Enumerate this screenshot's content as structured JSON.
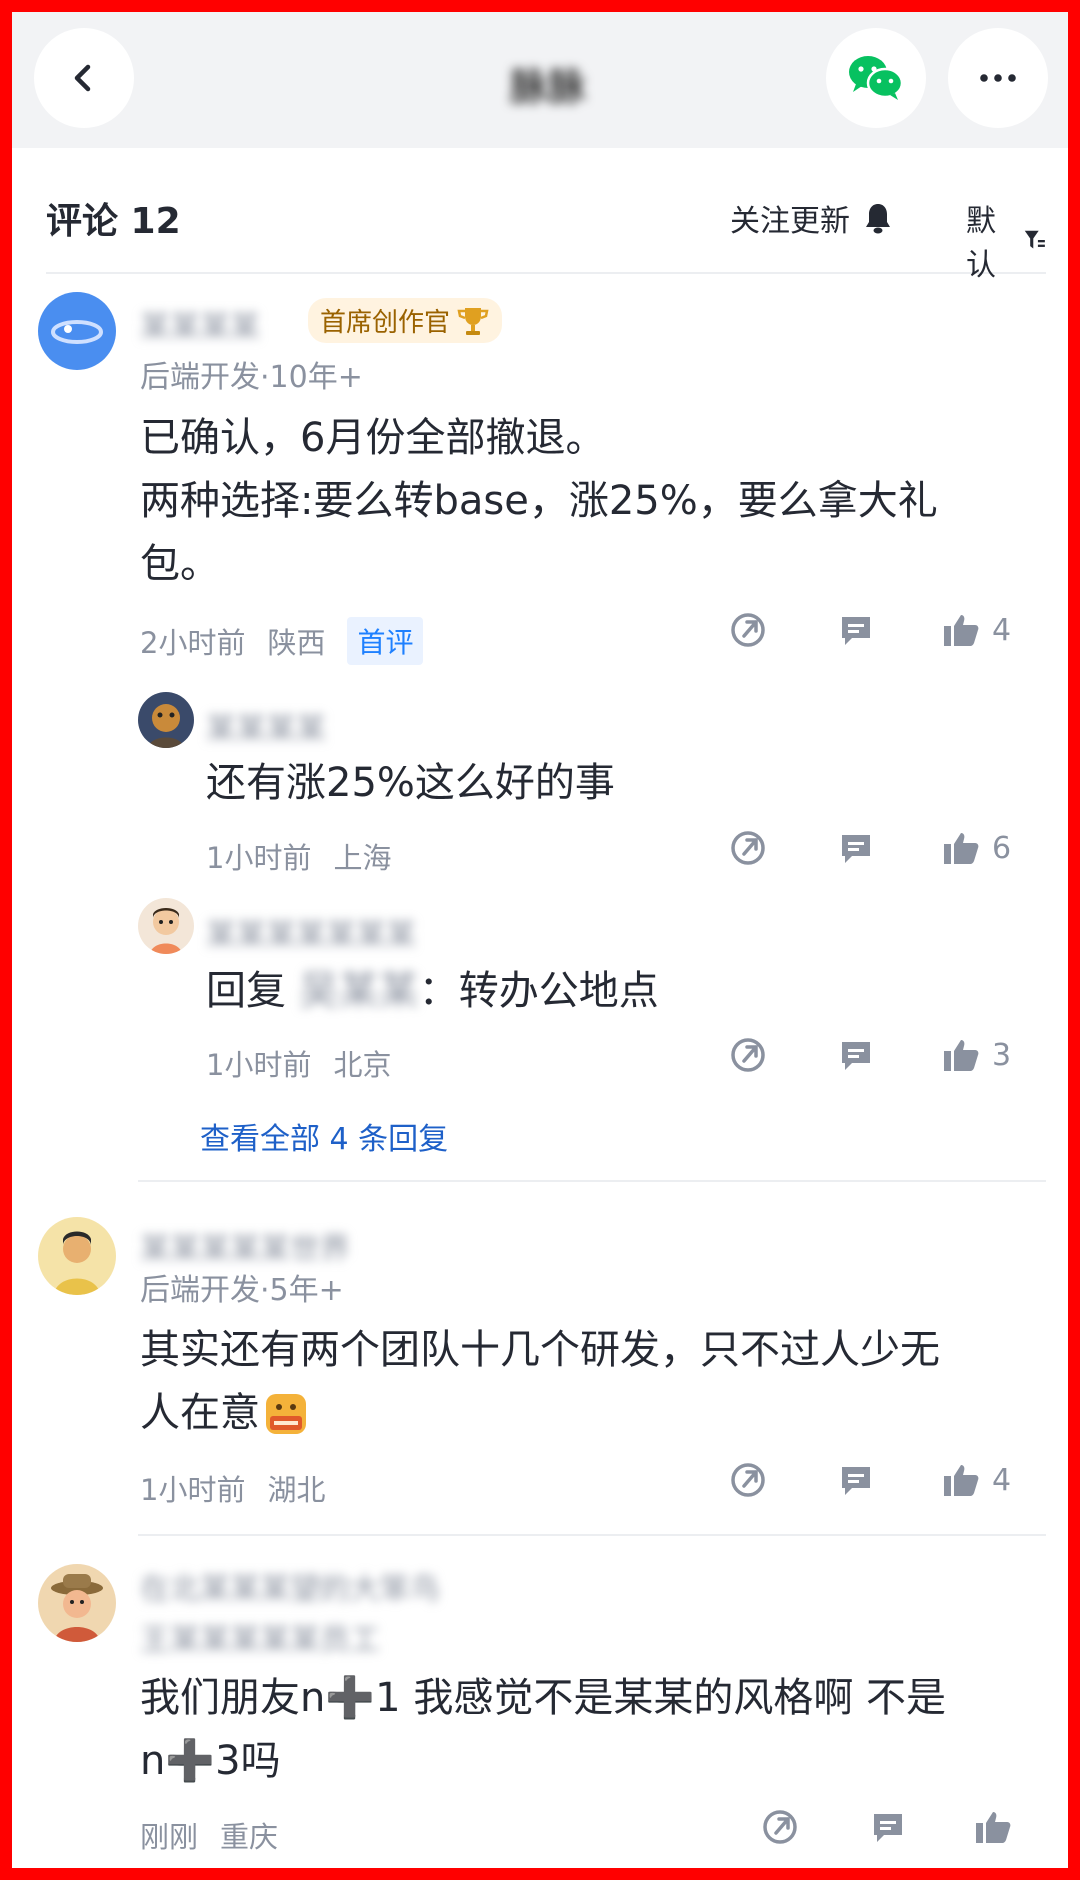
{
  "nav": {
    "title": "脉脉",
    "icons": [
      "back-icon",
      "wechat-icon",
      "more-icon"
    ]
  },
  "comments_header": {
    "title": "评论 12",
    "follow_label": "关注更新",
    "sort_label": "默认"
  },
  "comments": [
    {
      "username": "某某某某",
      "badge": "首席创作官",
      "role": "后端开发·10年+",
      "lines": [
        "已确认，6月份全部撤退。",
        "两种选择:要么转base，涨25%，要么拿大礼",
        "包。"
      ],
      "time": "2小时前",
      "location": "陕西",
      "tag": "首评",
      "likes": "4",
      "replies": [
        {
          "username": "某某某某",
          "text": "还有涨25%这么好的事",
          "time": "1小时前",
          "location": "上海",
          "likes": "6"
        },
        {
          "username": "某某某某某某某",
          "reply_prefix": "回复",
          "reply_to": "吴某某",
          "reply_sep": "：",
          "text": "转办公地点",
          "time": "1小时前",
          "location": "北京",
          "likes": "3"
        }
      ],
      "view_all": "查看全部 4 条回复"
    },
    {
      "username": "某某某某某世界",
      "role": "后端开发·5年+",
      "lines": [
        "其实还有两个团队十几个研发，只不过人少无",
        "人在意"
      ],
      "time": "1小时前",
      "location": "湖北",
      "likes": "4"
    },
    {
      "username": "在北某某某望的大笨鸟",
      "role": "王某某某某某员工",
      "lines": [
        "我们朋友n➕1 我感觉不是某某的风格啊 不是",
        "n➕3吗"
      ],
      "time": "刚刚",
      "location": "重庆",
      "likes": ""
    }
  ],
  "colors": {
    "accent": "#1e80ff",
    "text_primary": "#252933",
    "text_secondary": "#8a919f",
    "frame": "#ff0000",
    "topbar": "#f2f3f5",
    "wechat_green": "#07c160"
  }
}
